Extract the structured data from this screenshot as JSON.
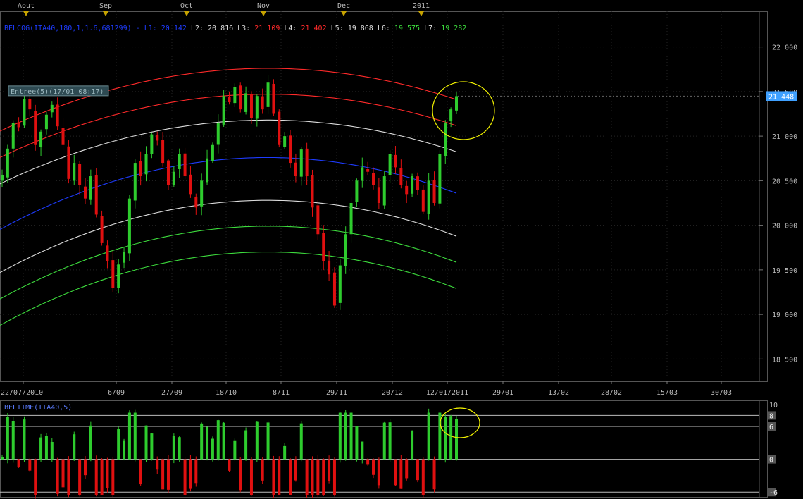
{
  "chart_data": [
    {
      "type": "candlestick",
      "top_month_labels": [
        "Aout",
        "Sep",
        "Oct",
        "Nov",
        "Dec",
        "2011"
      ],
      "indicator_title": "BELCOG(ITA40,180,1,1.6,681299)",
      "indicator_values": [
        {
          "label": "L1:",
          "value": "20 142",
          "color": "#1e3cff"
        },
        {
          "label": "L2:",
          "value": "20 816",
          "color": "#dddddd"
        },
        {
          "label": "L3:",
          "value": "21 109",
          "color": "#ff2a2a"
        },
        {
          "label": "L4:",
          "value": "21 402",
          "color": "#ff2a2a"
        },
        {
          "label": "L5:",
          "value": "19 868",
          "color": "#dddddd"
        },
        {
          "label": "L6:",
          "value": "19 575",
          "color": "#3ddc3d"
        },
        {
          "label": "L7:",
          "value": "19 282",
          "color": "#3ddc3d"
        }
      ],
      "entry_label": "Entree(5)(17/01 08:17)",
      "last_price": "21 448",
      "y_ticks": [
        "18 500",
        "19 000",
        "19 500",
        "20 000",
        "20 500",
        "21 000",
        "21 500",
        "22 000"
      ],
      "y_tick_values": [
        18500,
        19000,
        19500,
        20000,
        20500,
        21000,
        21500,
        22000
      ],
      "ylim": [
        18250,
        22400
      ],
      "x_ticks": [
        "22/07/2010",
        "6/09",
        "27/09",
        "18/10",
        "8/11",
        "29/11",
        "20/12",
        "12/01/2011",
        "29/01",
        "13/02",
        "28/02",
        "15/03",
        "30/03"
      ],
      "bands": [
        {
          "name": "L4",
          "color": "#ff2a2a",
          "edge_value": 21402,
          "peak_value": 21760
        },
        {
          "name": "L3",
          "color": "#ff2a2a",
          "edge_value": 21109,
          "peak_value": 21470
        },
        {
          "name": "L2",
          "color": "#dddddd",
          "edge_value": 20816,
          "peak_value": 21180
        },
        {
          "name": "L1",
          "color": "#1e3cff",
          "edge_value": 20350,
          "peak_value": 20760
        },
        {
          "name": "L5",
          "color": "#dddddd",
          "edge_value": 19868,
          "peak_value": 20280
        },
        {
          "name": "L6",
          "color": "#3ddc3d",
          "edge_value": 19575,
          "peak_value": 19990
        },
        {
          "name": "L7",
          "color": "#3ddc3d",
          "edge_value": 19282,
          "peak_value": 19700
        }
      ],
      "close_series": [
        20560,
        20860,
        21150,
        21100,
        21420,
        21300,
        20900,
        21050,
        21240,
        21350,
        21110,
        20900,
        20520,
        20700,
        20450,
        20300,
        20550,
        20120,
        19800,
        19600,
        19300,
        19560,
        19700,
        20300,
        20700,
        20550,
        20800,
        21020,
        20950,
        20700,
        20450,
        20600,
        20800,
        20550,
        20350,
        20200,
        20500,
        20750,
        20900,
        21150,
        21450,
        21380,
        21550,
        21300,
        21480,
        21200,
        21450,
        21300,
        21600,
        21250,
        20900,
        21000,
        20700,
        20550,
        20850,
        20550,
        20200,
        19900,
        19600,
        19450,
        19100,
        19550,
        19900,
        20250,
        20500,
        20650,
        20600,
        20450,
        20250,
        20550,
        20800,
        20650,
        20450,
        20350,
        20550,
        20400,
        20150,
        20500,
        20250,
        20800,
        21150,
        21300,
        21448
      ]
    },
    {
      "type": "bar",
      "title": "BELTIME(ITA40,5)",
      "y_ticks": [
        "10",
        "8",
        "6",
        "0",
        "-6"
      ],
      "y_tick_values": [
        10,
        8,
        6,
        0,
        -6
      ],
      "ylim": [
        -7,
        10.5
      ],
      "ref_levels": [
        8,
        6,
        0,
        -6
      ]
    }
  ]
}
